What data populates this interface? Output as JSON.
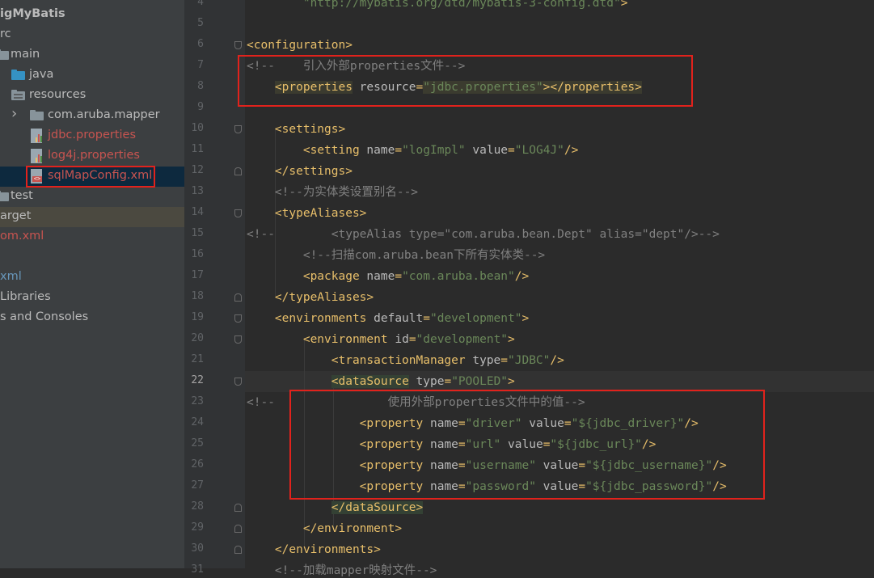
{
  "colors": {
    "accent_red": "#e1221c",
    "tag": "#e8bf6a",
    "attr": "#bababa",
    "value": "#6a8759",
    "comment": "#808080",
    "text": "#a9b7c6",
    "red_file": "#c75450",
    "blue_file": "#6897bb"
  },
  "project_tree": [
    {
      "label": "igMyBatis",
      "icon": "none",
      "color": "#bbbbbb",
      "bold": true
    },
    {
      "label": "rc",
      "icon": "none",
      "color": "#bbbbbb"
    },
    {
      "label": "main",
      "icon": "folder-icon",
      "color": "#bbbbbb"
    },
    {
      "label": "java",
      "icon": "source-folder-icon",
      "color": "#bbbbbb"
    },
    {
      "label": "resources",
      "icon": "resources-folder-icon",
      "color": "#bbbbbb"
    },
    {
      "label": "com.aruba.mapper",
      "icon": "package-folder-icon",
      "color": "#bbbbbb"
    },
    {
      "label": "jdbc.properties",
      "icon": "properties-file-icon",
      "color": "#c75450"
    },
    {
      "label": "log4j.properties",
      "icon": "properties-file-icon",
      "color": "#c75450"
    },
    {
      "label": "sqlMapConfig.xml",
      "icon": "xml-file-icon",
      "color": "#c75450",
      "selected": true
    },
    {
      "label": "test",
      "icon": "folder-icon",
      "color": "#bbbbbb"
    },
    {
      "label": "arget",
      "icon": "none",
      "color": "#bbbbbb",
      "highlight": true
    },
    {
      "label": "om.xml",
      "icon": "none",
      "color": "#c75450"
    },
    {
      "label": "",
      "icon": "none",
      "color": "#bbbbbb"
    },
    {
      "label": "xml",
      "icon": "none",
      "color": "#6897bb"
    },
    {
      "label": " Libraries",
      "icon": "none",
      "color": "#bbbbbb"
    },
    {
      "label": "s and Consoles",
      "icon": "none",
      "color": "#bbbbbb"
    }
  ],
  "editor": {
    "current_line": 22,
    "lines": [
      {
        "n": "4",
        "tokens": [
          [
            "v",
            "        \"http://mybatis.org/dtd/mybatis-3-config.dtd\""
          ],
          [
            "t",
            ">"
          ]
        ]
      },
      {
        "n": "5",
        "tokens": []
      },
      {
        "n": "6",
        "tokens": [
          [
            "t",
            "<configuration>"
          ]
        ]
      },
      {
        "n": "7",
        "tokens": [
          [
            "c",
            "<!--    引入外部properties文件-->"
          ]
        ]
      },
      {
        "n": "8",
        "tokens": [
          [
            "t",
            "    "
          ],
          [
            "tm",
            "<properties"
          ],
          [
            "a",
            " resource"
          ],
          [
            "t",
            "="
          ],
          [
            "vm",
            "\"jdbc.properties\""
          ],
          [
            "tm",
            "></properties>"
          ]
        ]
      },
      {
        "n": "9",
        "tokens": []
      },
      {
        "n": "10",
        "tokens": [
          [
            "t",
            "    <settings>"
          ]
        ]
      },
      {
        "n": "11",
        "tokens": [
          [
            "t",
            "        <setting"
          ],
          [
            "a",
            " name"
          ],
          [
            "t",
            "="
          ],
          [
            "v",
            "\"logImpl\""
          ],
          [
            "a",
            " value"
          ],
          [
            "t",
            "="
          ],
          [
            "v",
            "\"LOG4J\""
          ],
          [
            "t",
            "/>"
          ]
        ]
      },
      {
        "n": "12",
        "tokens": [
          [
            "t",
            "    </settings>"
          ]
        ]
      },
      {
        "n": "13",
        "tokens": [
          [
            "c",
            "    <!--为实体类设置别名-->"
          ]
        ]
      },
      {
        "n": "14",
        "tokens": [
          [
            "t",
            "    <typeAliases>"
          ]
        ]
      },
      {
        "n": "15",
        "tokens": [
          [
            "c",
            "<!--        <typeAlias type=\"com.aruba.bean.Dept\" alias=\"dept\"/>-->"
          ]
        ]
      },
      {
        "n": "16",
        "tokens": [
          [
            "c",
            "        <!--扫描com.aruba.bean下所有实体类-->"
          ]
        ]
      },
      {
        "n": "17",
        "tokens": [
          [
            "t",
            "        <package"
          ],
          [
            "a",
            " name"
          ],
          [
            "t",
            "="
          ],
          [
            "v",
            "\"com.aruba.bean\""
          ],
          [
            "t",
            "/>"
          ]
        ]
      },
      {
        "n": "18",
        "tokens": [
          [
            "t",
            "    </typeAliases>"
          ]
        ]
      },
      {
        "n": "19",
        "tokens": [
          [
            "t",
            "    <environments"
          ],
          [
            "a",
            " default"
          ],
          [
            "t",
            "="
          ],
          [
            "v",
            "\"development\""
          ],
          [
            "t",
            ">"
          ]
        ]
      },
      {
        "n": "20",
        "tokens": [
          [
            "t",
            "        <environment"
          ],
          [
            "a",
            " id"
          ],
          [
            "t",
            "="
          ],
          [
            "v",
            "\"development\""
          ],
          [
            "t",
            ">"
          ]
        ]
      },
      {
        "n": "21",
        "tokens": [
          [
            "t",
            "            <transactionManager"
          ],
          [
            "a",
            " type"
          ],
          [
            "t",
            "="
          ],
          [
            "v",
            "\"JDBC\""
          ],
          [
            "t",
            "/>"
          ]
        ]
      },
      {
        "n": "22",
        "tokens": [
          [
            "t",
            "            "
          ],
          [
            "tg",
            "<dataSource"
          ],
          [
            "a",
            " type"
          ],
          [
            "t",
            "="
          ],
          [
            "v",
            "\"POOLED\""
          ],
          [
            "t",
            ">"
          ]
        ]
      },
      {
        "n": "23",
        "tokens": [
          [
            "c",
            "<!--                使用外部properties文件中的值-->"
          ]
        ]
      },
      {
        "n": "24",
        "tokens": [
          [
            "t",
            "                <property"
          ],
          [
            "a",
            " name"
          ],
          [
            "t",
            "="
          ],
          [
            "v",
            "\"driver\""
          ],
          [
            "a",
            " value"
          ],
          [
            "t",
            "="
          ],
          [
            "v",
            "\"${jdbc_driver}\""
          ],
          [
            "t",
            "/>"
          ]
        ]
      },
      {
        "n": "25",
        "tokens": [
          [
            "t",
            "                <property"
          ],
          [
            "a",
            " name"
          ],
          [
            "t",
            "="
          ],
          [
            "v",
            "\"url\""
          ],
          [
            "a",
            " value"
          ],
          [
            "t",
            "="
          ],
          [
            "v",
            "\"${jdbc_url}\""
          ],
          [
            "t",
            "/>"
          ]
        ]
      },
      {
        "n": "26",
        "tokens": [
          [
            "t",
            "                <property"
          ],
          [
            "a",
            " name"
          ],
          [
            "t",
            "="
          ],
          [
            "v",
            "\"username\""
          ],
          [
            "a",
            " value"
          ],
          [
            "t",
            "="
          ],
          [
            "v",
            "\"${jdbc_username}\""
          ],
          [
            "t",
            "/>"
          ]
        ]
      },
      {
        "n": "27",
        "tokens": [
          [
            "t",
            "                <property"
          ],
          [
            "a",
            " name"
          ],
          [
            "t",
            "="
          ],
          [
            "v",
            "\"password\""
          ],
          [
            "a",
            " value"
          ],
          [
            "t",
            "="
          ],
          [
            "v",
            "\"${jdbc_password}\""
          ],
          [
            "t",
            "/>"
          ]
        ]
      },
      {
        "n": "28",
        "tokens": [
          [
            "t",
            "            "
          ],
          [
            "tg",
            "</dataSource>"
          ]
        ]
      },
      {
        "n": "29",
        "tokens": [
          [
            "t",
            "        </environment>"
          ]
        ]
      },
      {
        "n": "30",
        "tokens": [
          [
            "t",
            "    </environments>"
          ]
        ]
      },
      {
        "n": "31",
        "tokens": [
          [
            "c",
            "    <!--加载mapper映射文件-->"
          ]
        ]
      }
    ]
  }
}
